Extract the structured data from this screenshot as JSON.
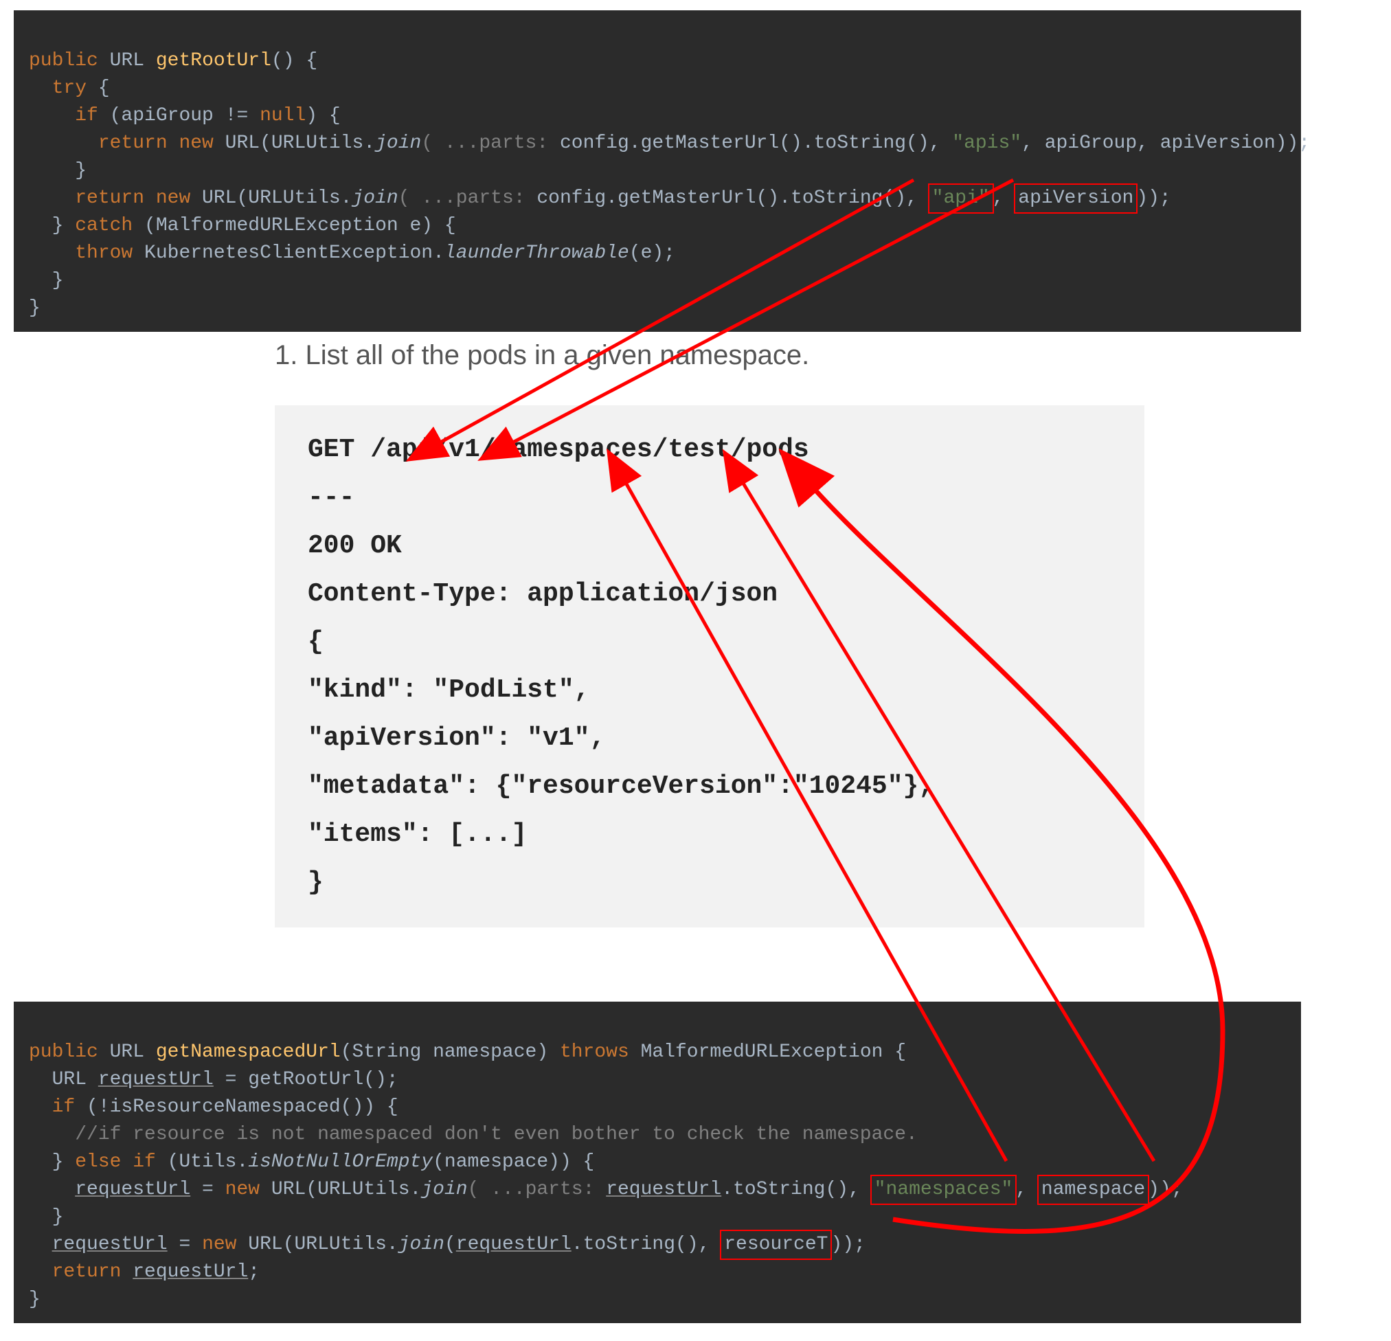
{
  "code1": {
    "l1_public": "public",
    "l1_url": "URL",
    "l1_method": "getRootUrl",
    "l1_tail": "() {",
    "l2_try": "try",
    "l2_tail": " {",
    "l3_if": "if",
    "l3_cond": " (apiGroup != ",
    "l3_null": "null",
    "l3_tail": ") {",
    "l4_return": "return new",
    "l4_a": " URL(URLUtils.",
    "l4_join": "join",
    "l4_hint": "( ...parts: ",
    "l4_b": "config.getMasterUrl().toString(), ",
    "l4_apis": "\"apis\"",
    "l4_c": ", apiGroup, apiVersion));",
    "l5": "}",
    "l6_return": "return new",
    "l6_a": " URL(URLUtils.",
    "l6_join": "join",
    "l6_hint": "( ...parts: ",
    "l6_b": "config.getMasterUrl().toString(), ",
    "l6_api": "\"api\"",
    "l6_comma": ", ",
    "l6_apiVersion": "apiVersion",
    "l6_tail": "));",
    "l7_catch_a": "} ",
    "l7_catch": "catch",
    "l7_catch_b": " (MalformedURLException e) {",
    "l8_throw": "throw",
    "l8_a": " KubernetesClientException.",
    "l8_launder": "launderThrowable",
    "l8_b": "(e);",
    "l9": "}",
    "l10": "}"
  },
  "heading": "1. List all of the pods in a given namespace.",
  "api": {
    "l1": "GET /api/v1/namespaces/test/pods",
    "l2": "---",
    "l3": "200 OK",
    "l4": "Content-Type: application/json",
    "l5": "{",
    "l6": "   \"kind\": \"PodList\",",
    "l7": "   \"apiVersion\": \"v1\",",
    "l8": "   \"metadata\": {\"resourceVersion\":\"10245\"},",
    "l9": "   \"items\": [...]",
    "l10": "}"
  },
  "code2": {
    "l1_public": "public",
    "l1_url": " URL ",
    "l1_method": "getNamespacedUrl",
    "l1_params": "(String namespace) ",
    "l1_throws": "throws",
    "l1_tail": " MalformedURLException {",
    "l2_a": "URL ",
    "l2_req": "requestUrl",
    "l2_b": " = getRootUrl();",
    "l3_if": "if",
    "l3_cond": " (!isResourceNamespaced()) {",
    "l4_comment": "//if resource is not namespaced don't even bother to check the namespace.",
    "l5_a": "} ",
    "l5_else": "else if",
    "l5_b": " (Utils.",
    "l5_isnn": "isNotNullOrEmpty",
    "l5_c": "(namespace)) {",
    "l6_req": "requestUrl",
    "l6_a": " = ",
    "l6_new": "new",
    "l6_b": " URL(URLUtils.",
    "l6_join": "join",
    "l6_hint": "( ...parts: ",
    "l6_req2": "requestUrl",
    "l6_c": ".toString(), ",
    "l6_ns": "\"namespaces\"",
    "l6_comma": ", ",
    "l6_nsvar": "namespace",
    "l6_tail": "));",
    "l7": "}",
    "l8_req": "requestUrl",
    "l8_a": " = ",
    "l8_new": "new",
    "l8_b": " URL(URLUtils.",
    "l8_join": "join",
    "l8_c": "(",
    "l8_req2": "requestUrl",
    "l8_d": ".toString(), ",
    "l8_resT": "resourceT",
    "l8_tail": "));",
    "l9_return": "return",
    "l9_sp": " ",
    "l9_req": "requestUrl",
    "l9_tail": ";",
    "l10": "}"
  }
}
